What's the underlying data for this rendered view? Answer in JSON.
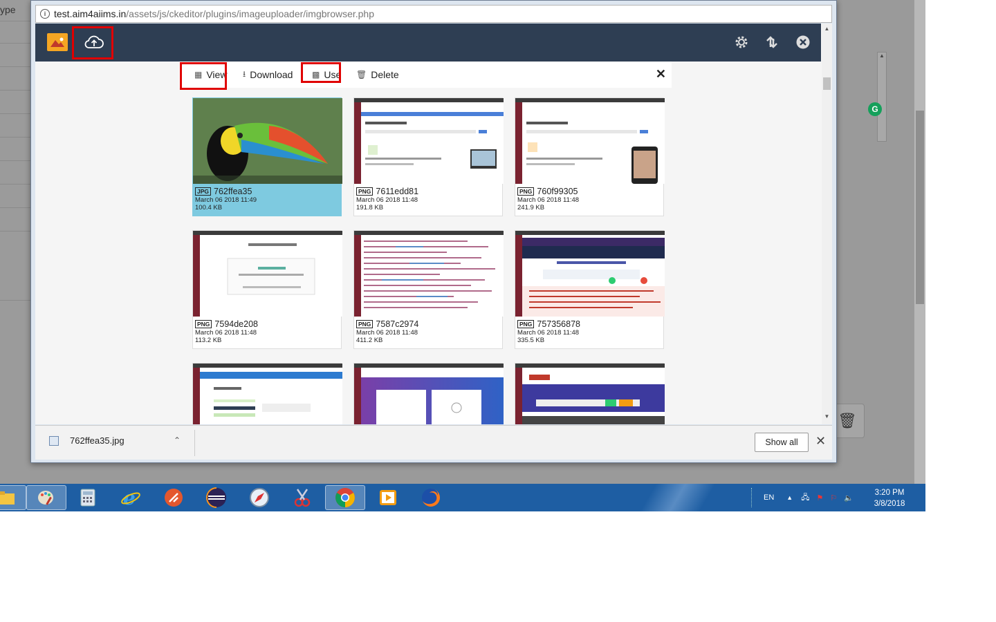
{
  "background": {
    "label_partial": "ype"
  },
  "url": {
    "host": "test.aim4aiims.in",
    "path": "/assets/js/ckeditor/plugins/imageuploader/imgbrowser.php"
  },
  "toolbar": {
    "view_label": "View",
    "download_label": "Download",
    "use_label": "Use",
    "delete_label": "Delete"
  },
  "images": [
    {
      "ext": "JPG",
      "name": "762ffea35",
      "date": "March 06 2018 11:49",
      "size": "100.4 KB",
      "selected": true
    },
    {
      "ext": "PNG",
      "name": "7611edd81",
      "date": "March 06 2018 11:48",
      "size": "191.8 KB",
      "selected": false
    },
    {
      "ext": "PNG",
      "name": "760f99305",
      "date": "March 06 2018 11:48",
      "size": "241.9 KB",
      "selected": false
    },
    {
      "ext": "PNG",
      "name": "7594de208",
      "date": "March 06 2018 11:48",
      "size": "113.2 KB",
      "selected": false
    },
    {
      "ext": "PNG",
      "name": "7587c2974",
      "date": "March 06 2018 11:48",
      "size": "411.2 KB",
      "selected": false
    },
    {
      "ext": "PNG",
      "name": "757356878",
      "date": "March 06 2018 11:48",
      "size": "335.5 KB",
      "selected": false
    }
  ],
  "downloads": {
    "file_name": "762ffea35.jpg",
    "show_all_label": "Show all"
  },
  "taskbar": {
    "language": "EN",
    "time": "3:20 PM",
    "date": "3/8/2018",
    "apps": [
      "file-explorer-icon",
      "paint-icon",
      "calculator-icon",
      "internet-explorer-icon",
      "filezilla-icon",
      "eclipse-icon",
      "safari-icon",
      "snipping-tool-icon",
      "chrome-icon",
      "media-player-icon",
      "firefox-icon"
    ]
  },
  "colors": {
    "topbar": "#2e3e53",
    "selected_card": "#7ecae0",
    "highlight_box": "#e00000",
    "taskbar": "#1e5ea3"
  }
}
